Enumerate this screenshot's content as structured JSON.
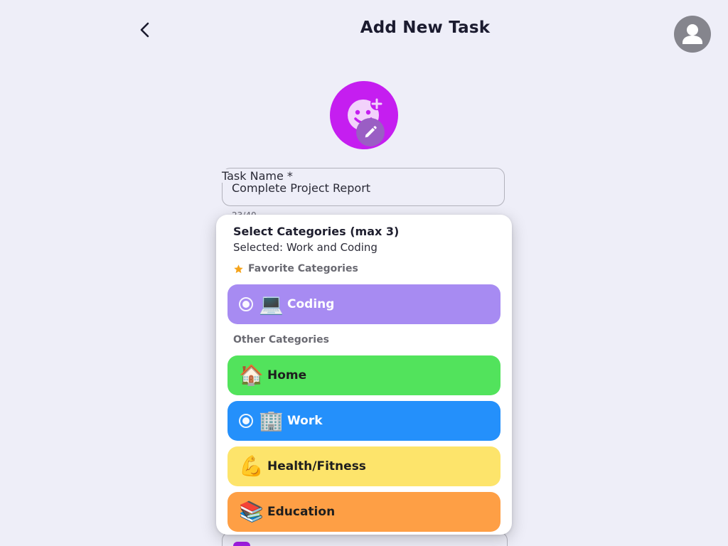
{
  "header": {
    "title": "Add New Task"
  },
  "form": {
    "task_name_label": "Task Name *",
    "task_name_value": "Complete Project Report",
    "char_count": "23/40"
  },
  "dropdown": {
    "title": "Select Categories (max 3)",
    "selected_text": "Selected: Work and Coding",
    "favorite_label": "Favorite Categories",
    "other_label": "Other Categories",
    "favorites": [
      {
        "label": "Coding",
        "emoji": "💻",
        "selected": true,
        "color": "#a78bf2",
        "text_color": "#ffffff"
      }
    ],
    "others": [
      {
        "label": "Home",
        "emoji": "🏠",
        "selected": false,
        "color": "#52e35c",
        "text_color": "#1e1e1e"
      },
      {
        "label": "Work",
        "emoji": "🏢",
        "selected": true,
        "color": "#2490fb",
        "text_color": "#ffffff"
      },
      {
        "label": "Health/Fitness",
        "emoji": "💪",
        "selected": false,
        "color": "#fde46b",
        "text_color": "#1e1e1e"
      },
      {
        "label": "Education",
        "emoji": "📚",
        "selected": false,
        "color": "#fe9f45",
        "text_color": "#1e1e1e"
      }
    ]
  },
  "colors": {
    "accent": "#c51ef0",
    "background": "#eeeef8"
  }
}
